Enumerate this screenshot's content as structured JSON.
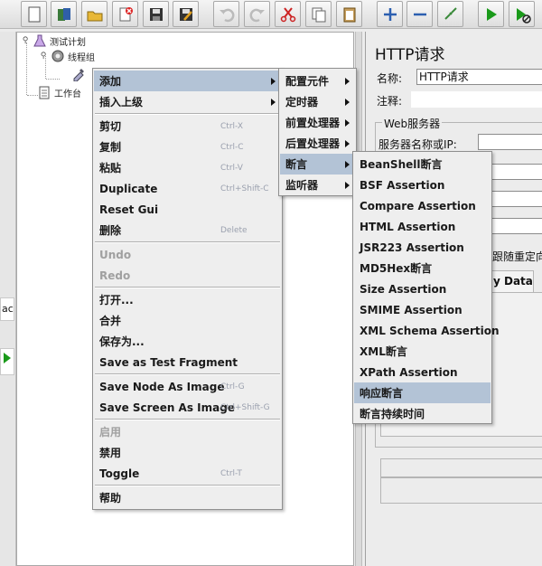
{
  "toolbar": {
    "buttons": [
      {
        "name": "new-icon",
        "enabled": true
      },
      {
        "name": "templates-icon",
        "enabled": true
      },
      {
        "name": "open-icon",
        "enabled": true
      },
      {
        "name": "close-icon",
        "enabled": true
      },
      {
        "name": "save-icon",
        "enabled": true
      },
      {
        "name": "save-as-icon",
        "enabled": true
      },
      {
        "name": "undo-icon",
        "enabled": false
      },
      {
        "name": "redo-icon",
        "enabled": false
      },
      {
        "name": "cut-icon",
        "enabled": true
      },
      {
        "name": "copy-icon",
        "enabled": true
      },
      {
        "name": "paste-icon",
        "enabled": true
      },
      {
        "name": "expand-icon",
        "enabled": true
      },
      {
        "name": "collapse-icon",
        "enabled": true
      },
      {
        "name": "toggle-icon",
        "enabled": true
      },
      {
        "name": "start-icon",
        "enabled": true
      },
      {
        "name": "start-no-pause-icon",
        "enabled": true
      }
    ]
  },
  "tree": {
    "test_plan": "测试计划",
    "thread_group": "线程组",
    "workbench": "工作台"
  },
  "left_strip": {
    "clipped_text": "ac"
  },
  "right_pane": {
    "title": "HTTP请求",
    "name_label": "名称:",
    "name_value": "HTTP请求",
    "comment_label": "注释:",
    "web_server_group": "Web服务器",
    "server_name_label": "服务器名称或IP:",
    "redirect_label": "跟随重定向",
    "body_data_tab": "y Data"
  },
  "context_menu": {
    "items": [
      {
        "label": "添加",
        "shortcut": "",
        "submenu": true,
        "selected": true,
        "disabled": false
      },
      {
        "label": "插入上级",
        "shortcut": "",
        "submenu": true,
        "selected": false,
        "disabled": false
      },
      {
        "separator": true
      },
      {
        "label": "剪切",
        "shortcut": "Ctrl-X",
        "disabled": false
      },
      {
        "label": "复制",
        "shortcut": "Ctrl-C",
        "disabled": false
      },
      {
        "label": "粘贴",
        "shortcut": "Ctrl-V",
        "disabled": false
      },
      {
        "label": "Duplicate",
        "shortcut": "Ctrl+Shift-C",
        "disabled": false
      },
      {
        "label": "Reset Gui",
        "shortcut": "",
        "disabled": false
      },
      {
        "label": "删除",
        "shortcut": "Delete",
        "disabled": false
      },
      {
        "separator": true
      },
      {
        "label": "Undo",
        "shortcut": "",
        "disabled": true
      },
      {
        "label": "Redo",
        "shortcut": "",
        "disabled": true
      },
      {
        "separator": true
      },
      {
        "label": "打开...",
        "shortcut": "",
        "disabled": false
      },
      {
        "label": "合并",
        "shortcut": "",
        "disabled": false
      },
      {
        "label": "保存为...",
        "shortcut": "",
        "disabled": false
      },
      {
        "label": "Save as Test Fragment",
        "shortcut": "",
        "disabled": false
      },
      {
        "separator": true
      },
      {
        "label": "Save Node As Image",
        "shortcut": "Ctrl-G",
        "disabled": false
      },
      {
        "label": "Save Screen As Image",
        "shortcut": "Ctrl+Shift-G",
        "disabled": false
      },
      {
        "separator": true
      },
      {
        "label": "启用",
        "shortcut": "",
        "disabled": true
      },
      {
        "label": "禁用",
        "shortcut": "",
        "disabled": false
      },
      {
        "label": "Toggle",
        "shortcut": "Ctrl-T",
        "disabled": false
      },
      {
        "separator": true
      },
      {
        "label": "帮助",
        "shortcut": "",
        "disabled": false
      }
    ]
  },
  "add_submenu": {
    "items": [
      {
        "label": "配置元件",
        "submenu": true,
        "selected": false
      },
      {
        "label": "定时器",
        "submenu": true,
        "selected": false
      },
      {
        "label": "前置处理器",
        "submenu": true,
        "selected": false
      },
      {
        "label": "后置处理器",
        "submenu": true,
        "selected": false
      },
      {
        "label": "断言",
        "submenu": true,
        "selected": true
      },
      {
        "label": "监听器",
        "submenu": true,
        "selected": false
      }
    ]
  },
  "assertion_submenu": {
    "items": [
      {
        "label": "BeanShell断言",
        "selected": false
      },
      {
        "label": "BSF Assertion",
        "selected": false
      },
      {
        "label": "Compare Assertion",
        "selected": false
      },
      {
        "label": "HTML Assertion",
        "selected": false
      },
      {
        "label": "JSR223 Assertion",
        "selected": false
      },
      {
        "label": "MD5Hex断言",
        "selected": false
      },
      {
        "label": "Size Assertion",
        "selected": false
      },
      {
        "label": "SMIME Assertion",
        "selected": false
      },
      {
        "label": "XML Schema Assertion",
        "selected": false
      },
      {
        "label": "XML断言",
        "selected": false
      },
      {
        "label": "XPath Assertion",
        "selected": false
      },
      {
        "label": "响应断言",
        "selected": true
      },
      {
        "label": "断言持续时间",
        "selected": false
      }
    ]
  },
  "colors": {
    "menu_bg": "#eeeeee",
    "menu_highlight": "#b3c3d6",
    "shortcut_text": "#9aa0ae",
    "disabled_text": "#a0a0a0"
  }
}
